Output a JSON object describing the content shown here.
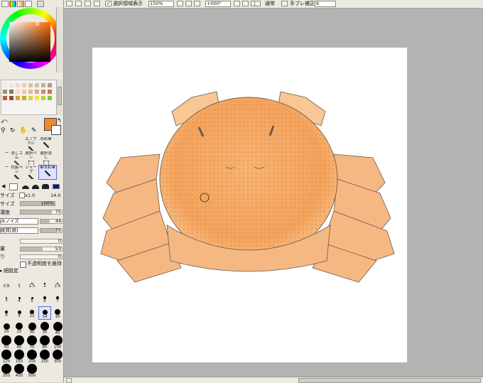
{
  "toolbar": {
    "selection_visible_label": "選択領域表示",
    "zoom": "150%",
    "rotation": "+000°",
    "blend_mode": "通常",
    "stabilizer_label": "手ブレ補正",
    "stabilizer_value": "6"
  },
  "tool_grid": [
    {
      "label": "エアブラシ"
    },
    {
      "label": "水彩筆"
    },
    {
      "label": "ー"
    },
    {
      "label": "消しゴム"
    },
    {
      "label": "選択ペン"
    },
    {
      "label": "選択消し"
    },
    {
      "label": "ー"
    },
    {
      "label": "色鉛ペン"
    },
    {
      "label": "シャープ"
    },
    {
      "label": "筆水彩筆"
    }
  ],
  "brush": {
    "size_label": "サイズ",
    "size_mult": "x1.0",
    "size_value": "14.0",
    "min_size_label": "サイズ",
    "min_size_value": "100%",
    "density_label": "濃度",
    "density_value": "75",
    "density_level": 0.75,
    "texture_shape": "みノイズ",
    "texture_shape_value": "44",
    "texture_paper": "紙質[感]",
    "texture_paper_value": "76",
    "blend_value": "0",
    "water_label": "量",
    "water_value": "53",
    "persistence_label": "り",
    "persistence_value": "0",
    "keep_opacity_label": "不透明度を維持",
    "detail_label": "細設定"
  },
  "brush_sizes": [
    {
      "label": "0.8",
      "d": 1
    },
    {
      "label": "1",
      "d": 1
    },
    {
      "label": "1.5",
      "d": 1.5
    },
    {
      "label": "2",
      "d": 1.5
    },
    {
      "label": "2.6",
      "d": 2
    },
    {
      "label": "3",
      "d": 2.5
    },
    {
      "label": "4",
      "d": 3
    },
    {
      "label": "5",
      "d": 3
    },
    {
      "label": "6",
      "d": 4
    },
    {
      "label": "7",
      "d": 4
    },
    {
      "label": "8",
      "d": 4.5
    },
    {
      "label": "9",
      "d": 5
    },
    {
      "label": "12",
      "d": 6
    },
    {
      "label": "14",
      "d": 7
    },
    {
      "label": "16",
      "d": 8
    },
    {
      "label": "20",
      "d": 9
    },
    {
      "label": "25",
      "d": 10
    },
    {
      "label": "30",
      "d": 11
    },
    {
      "label": "35",
      "d": 12
    },
    {
      "label": "40",
      "d": 13
    },
    {
      "label": "50",
      "d": 14
    },
    {
      "label": "60",
      "d": 14
    },
    {
      "label": "70",
      "d": 14
    },
    {
      "label": "80",
      "d": 14
    },
    {
      "label": "100",
      "d": 14
    },
    {
      "label": "120",
      "d": 14
    },
    {
      "label": "160",
      "d": 14
    },
    {
      "label": "200",
      "d": 14
    },
    {
      "label": "250",
      "d": 14
    },
    {
      "label": "300",
      "d": 14
    },
    {
      "label": "350",
      "d": 14
    },
    {
      "label": "400",
      "d": 14
    },
    {
      "label": "500",
      "d": 14
    }
  ],
  "selected_size": "14",
  "colors": {
    "foreground": "#f0892f",
    "background": "#ffffff",
    "shell": "#f3a35c",
    "shell_light": "#f8c793",
    "outline": "#6d5a4c"
  }
}
